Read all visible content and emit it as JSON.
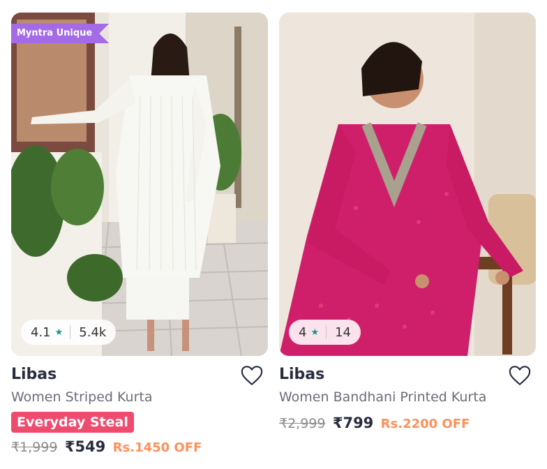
{
  "products": [
    {
      "badge": "Myntra Unique",
      "rating": "4.1",
      "rating_count": "5.4k",
      "brand": "Libas",
      "title": "Women Striped Kurta",
      "promo": "Everyday Steal",
      "mrp": "₹1,999",
      "price": "₹549",
      "discount": "Rs.1450 OFF",
      "image_desc": "woman in white striped kurta set",
      "colors": {
        "rating_star": "#14958f",
        "promo_bg": "#ee4b6e",
        "discount": "#ff905a"
      }
    },
    {
      "rating": "4",
      "rating_count": "14",
      "brand": "Libas",
      "title": "Women Bandhani Printed Kurta",
      "mrp": "₹2,999",
      "price": "₹799",
      "discount": "Rs.2200 OFF",
      "image_desc": "woman in pink bandhani kurta",
      "colors": {
        "rating_star": "#14958f",
        "discount": "#ff905a"
      }
    }
  ],
  "icons": {
    "rating_star": "star-icon",
    "wishlist": "heart-outline-icon",
    "badge_color": "#a36be6"
  }
}
